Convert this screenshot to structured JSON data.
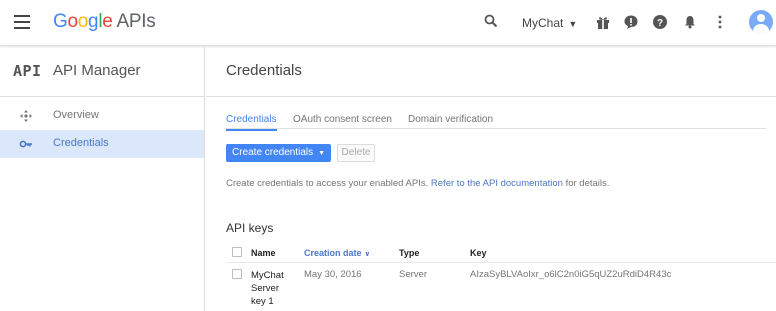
{
  "header": {
    "brand": [
      "G",
      "o",
      "o",
      "g",
      "l",
      "e"
    ],
    "product": "APIs",
    "project": "MyChat",
    "icons": [
      "menu-icon",
      "search-icon",
      "gift-icon",
      "feedback-icon",
      "help-icon",
      "notifications-icon",
      "more-vert-icon",
      "account-avatar"
    ]
  },
  "sidebar": {
    "logo": "API",
    "title": "API Manager",
    "items": [
      {
        "label": "Overview",
        "icon": "overview-icon"
      },
      {
        "label": "Credentials",
        "icon": "key-icon",
        "active": true
      }
    ]
  },
  "main": {
    "title": "Credentials",
    "tabs": [
      {
        "label": "Credentials",
        "active": true
      },
      {
        "label": "OAuth consent screen"
      },
      {
        "label": "Domain verification"
      }
    ],
    "create_button": "Create credentials",
    "delete_button": "Delete",
    "info_text": "Create credentials to access your enabled APIs.",
    "info_link": "Refer to the API documentation",
    "info_suffix": "for details.",
    "section_title": "API keys",
    "table": {
      "headers": {
        "name": "Name",
        "creation_date": "Creation date",
        "type": "Type",
        "key": "Key"
      },
      "rows": [
        {
          "name_lines": [
            "MyChat",
            "Server",
            "key 1"
          ],
          "creation_date": "May 30, 2016",
          "type": "Server",
          "key": "AIzaSyBLVAoIxr_o6lC2n0iG5qUZ2uRdiD4R43c"
        }
      ]
    }
  },
  "colors": {
    "accent": "#4285f4",
    "active_bg": "#dbe7fa",
    "link": "#4a77c9"
  }
}
